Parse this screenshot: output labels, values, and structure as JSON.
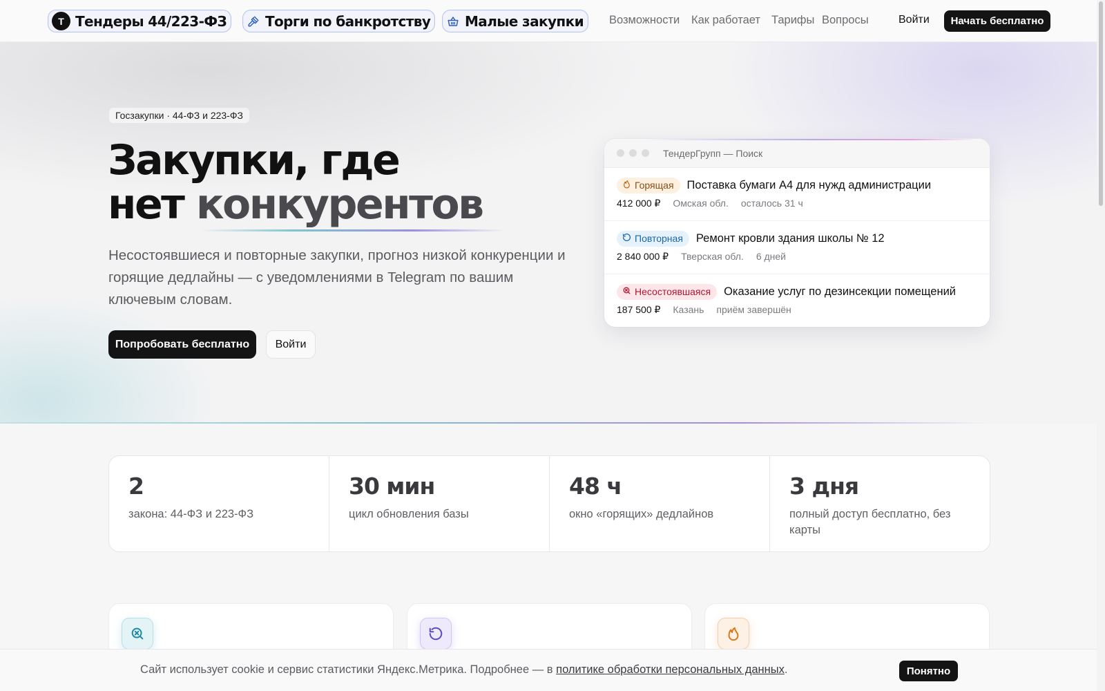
{
  "nav": {
    "products": [
      {
        "label": "Тендеры 44/223-ФЗ",
        "logo_letter": "Т",
        "icon": "brand-logo"
      },
      {
        "label": "Торги по банкротству",
        "icon": "gavel-icon"
      },
      {
        "label": "Малые закупки",
        "icon": "basket-icon"
      }
    ],
    "links": [
      "Возможности",
      "Как работает",
      "Тарифы",
      "Вопросы"
    ],
    "login": "Войти",
    "cta": "Начать бесплатно"
  },
  "hero": {
    "kicker": "Госзакупки · 44-ФЗ и 223-ФЗ",
    "headline_line1": "Закупки, где",
    "headline_line2_plain": "нет ",
    "headline_line2_accent": "конкурентов",
    "lead": "Несостоявшиеся и повторные закупки, прогноз низкой конкуренции и горящие дедлайны — с уведомлениями в Telegram по вашим ключевым словам.",
    "primary_button": "Попробовать бесплатно",
    "secondary_button": "Войти"
  },
  "mock": {
    "title": "ТендерГрупп — Поиск",
    "rows": [
      {
        "badge": "Горящая",
        "badge_type": "hot",
        "badge_icon": "flame-icon",
        "title": "Поставка бумаги А4 для нужд администрации",
        "price": "412 000 ₽",
        "region": "Омская обл.",
        "status": "осталось 31 ч"
      },
      {
        "badge": "Повторная",
        "badge_type": "repeat",
        "badge_icon": "refresh-icon",
        "title": "Ремонт кровли здания школы № 12",
        "price": "2 840 000 ₽",
        "region": "Тверская обл.",
        "status": "6 дней"
      },
      {
        "badge": "Несостоявшаяся",
        "badge_type": "failed",
        "badge_icon": "search-x-icon",
        "title": "Оказание услуг по дезинсекции помещений",
        "price": "187 500 ₽",
        "region": "Казань",
        "status": "приём завершён"
      }
    ]
  },
  "stats": [
    {
      "value": "2",
      "label": "закона: 44-ФЗ и 223-ФЗ"
    },
    {
      "value": "30 мин",
      "label": "цикл обновления базы"
    },
    {
      "value": "48 ч",
      "label": "окно «горящих» дедлайнов"
    },
    {
      "value": "3 дня",
      "label": "полный доступ бесплатно, без карты"
    }
  ],
  "features": [
    {
      "icon": "search-x-icon"
    },
    {
      "icon": "refresh-icon"
    },
    {
      "icon": "flame-icon"
    }
  ],
  "cookie": {
    "text_before": "Сайт использует cookie и сервис статистики Яндекс.Метрика. Подробнее — в ",
    "link": "политике обработки персональных данных",
    "text_after": ".",
    "button": "Понятно"
  },
  "colors": {
    "dark": "#141414",
    "hot": "#8a4f12",
    "repeat": "#1b67a6",
    "failed": "#b0162f",
    "accent_teal": "#7fc6cf",
    "accent_violet": "#a58be0"
  }
}
